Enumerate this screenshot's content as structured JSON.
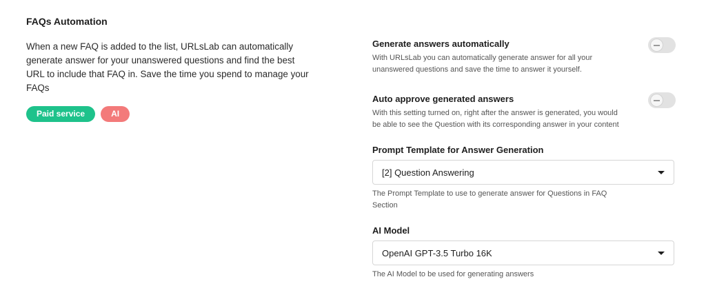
{
  "section": {
    "title": "FAQs Automation",
    "description": "When a new FAQ is added to the list, URLsLab can automatically generate answer for your unanswered questions and find the best URL to include that FAQ in. Save the time you spend to manage your FAQs",
    "tags": [
      {
        "label": "Paid service",
        "color": "#1ec28b"
      },
      {
        "label": "AI",
        "color": "#f37a7a"
      }
    ]
  },
  "settings": {
    "generate_answers": {
      "title": "Generate answers automatically",
      "description": "With URLsLab you can automatically generate answer for all your unanswered questions and save the time to answer it yourself.",
      "enabled": false
    },
    "auto_approve": {
      "title": "Auto approve generated answers",
      "description": "With this setting turned on, right after the answer is generated, you would be able to see the Question with its corresponding answer in your content",
      "enabled": false
    },
    "prompt_template": {
      "label": "Prompt Template for Answer Generation",
      "value": "[2] Question Answering",
      "help": "The Prompt Template to use to generate answer for Questions in FAQ Section"
    },
    "ai_model": {
      "label": "AI Model",
      "value": "OpenAI GPT-3.5 Turbo 16K",
      "help": "The AI Model to be used for generating answers"
    }
  },
  "icons": {
    "dropdown": "caret-down-icon",
    "toggle_off": "minus-icon"
  }
}
